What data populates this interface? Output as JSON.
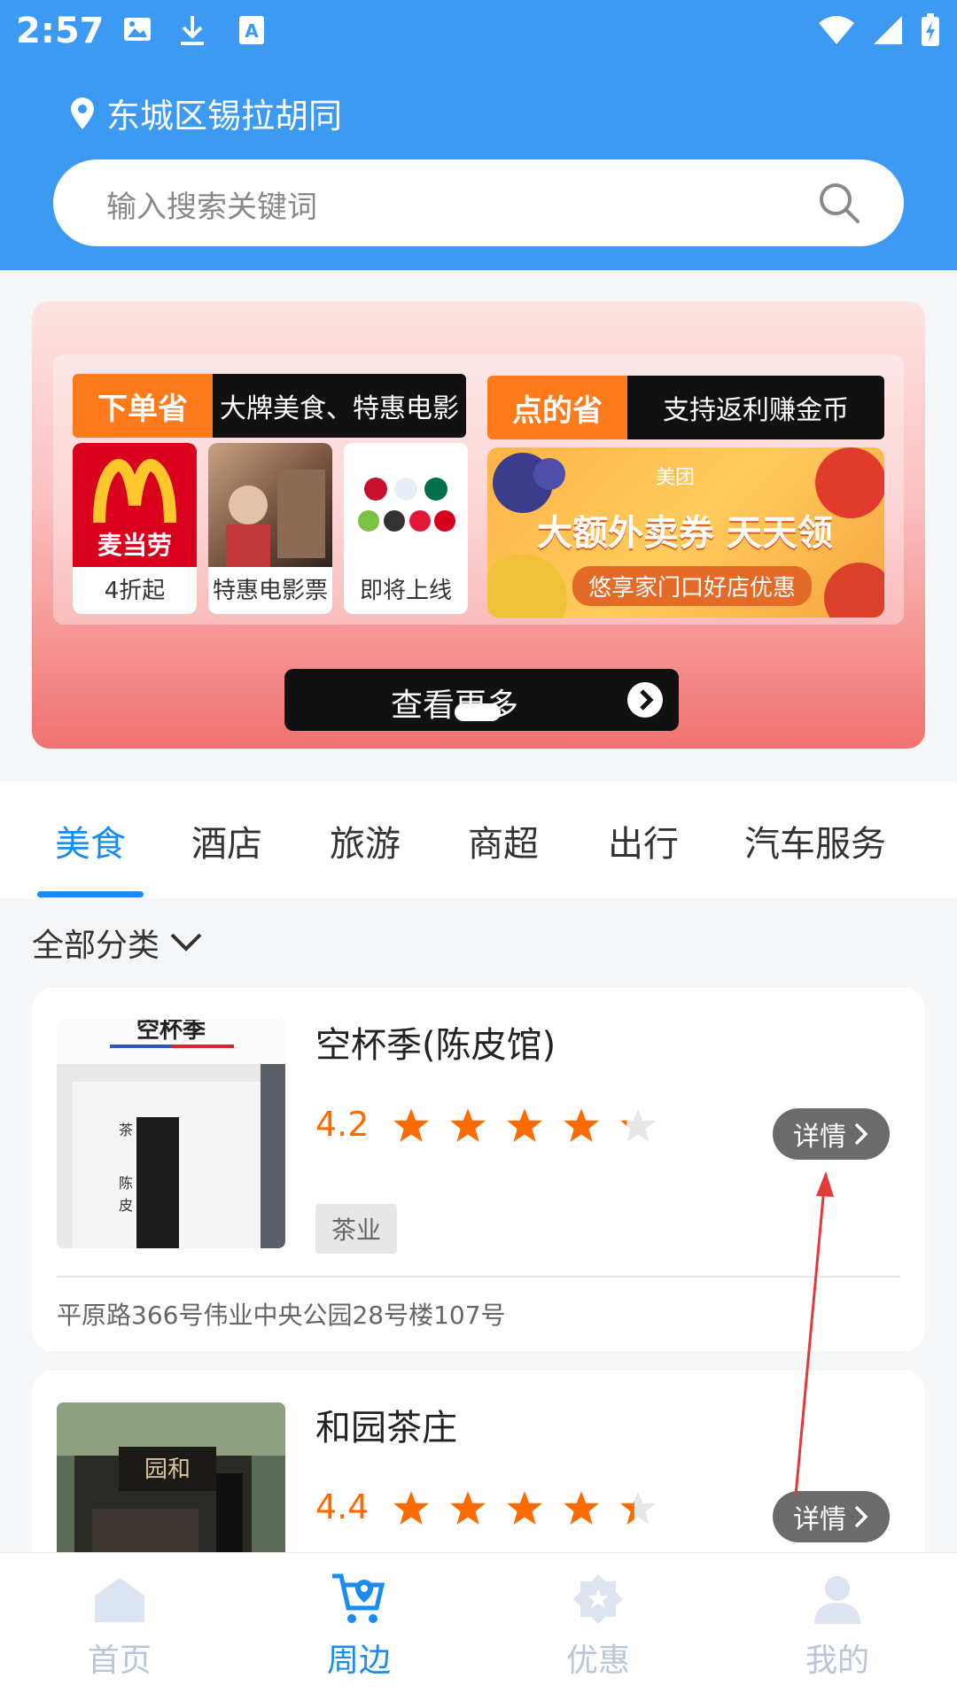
{
  "status_bar": {
    "time": "2:57"
  },
  "header": {
    "location": "东城区锡拉胡同",
    "search_placeholder": "输入搜索关键词"
  },
  "banner": {
    "left_tag": {
      "orange": "下单省",
      "black": "大牌美食、特惠电影"
    },
    "right_tag": {
      "orange": "点的省",
      "black": "支持返利赚金币"
    },
    "cards": [
      {
        "label": "4折起"
      },
      {
        "label": "特惠电影票"
      },
      {
        "label": "即将上线"
      }
    ],
    "mcd_text": "麦当劳",
    "meituan": {
      "brand": "美团",
      "title": "大额外卖券 天天领",
      "subtitle": "悠享家门口好店优惠"
    },
    "more_label": "查看更多"
  },
  "tabs": [
    "美食",
    "酒店",
    "旅游",
    "商超",
    "出行",
    "汽车服务"
  ],
  "active_tab": "美食",
  "filter_label": "全部分类",
  "stores": [
    {
      "name": "空杯季(陈皮馆)",
      "rating": "4.2",
      "rating_value": 4.2,
      "tag": "茶业",
      "address": "平原路366号伟业中央公园28号楼107号",
      "detail": "详情",
      "sign": "空杯季"
    },
    {
      "name": "和园茶庄",
      "rating": "4.4",
      "rating_value": 4.4,
      "detail": "详情",
      "sign": "园和"
    }
  ],
  "bottom_nav": [
    {
      "label": "首页",
      "icon": "home-icon"
    },
    {
      "label": "周边",
      "icon": "nearby-cart-icon"
    },
    {
      "label": "优惠",
      "icon": "discount-badge-icon"
    },
    {
      "label": "我的",
      "icon": "profile-icon"
    }
  ],
  "colors": {
    "header_blue": "#3d9af3",
    "accent_blue": "#1a8cf0",
    "rating_orange": "#ff6a00",
    "star_orange": "#ff6a00",
    "star_empty": "#e6e6e6"
  }
}
